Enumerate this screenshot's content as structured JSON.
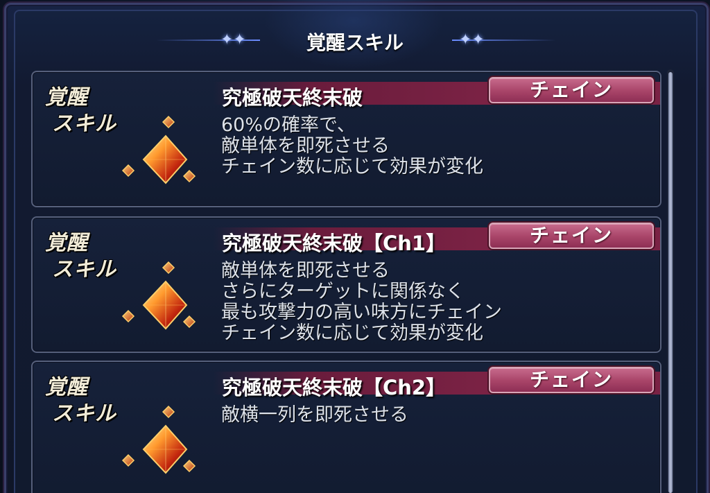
{
  "header": {
    "title": "覚醒スキル",
    "star_left": "✦✦",
    "star_right": "✦✦"
  },
  "colors": {
    "name_bar": "#7a2244",
    "chain_badge": "#a84468",
    "card_border": "#56607c",
    "text": "#dde2ea"
  },
  "cards": [
    {
      "label_line1": "覚醒",
      "label_line2": "スキル",
      "icon": "red-crystal-icon",
      "name": "究極破天終末破",
      "badge": "チェイン",
      "desc": [
        "60%の確率で、",
        "敵単体を即死させる",
        "チェイン数に応じて効果が変化"
      ]
    },
    {
      "label_line1": "覚醒",
      "label_line2": "スキル",
      "icon": "red-crystal-icon",
      "name": "究極破天終末破【Ch1】",
      "badge": "チェイン",
      "desc": [
        "敵単体を即死させる",
        "さらにターゲットに関係なく",
        "最も攻撃力の高い味方にチェイン",
        "チェイン数に応じて効果が変化"
      ]
    },
    {
      "label_line1": "覚醒",
      "label_line2": "スキル",
      "icon": "red-crystal-icon",
      "name": "究極破天終末破【Ch2】",
      "badge": "チェイン",
      "desc": [
        "敵横一列を即死させる"
      ]
    }
  ]
}
